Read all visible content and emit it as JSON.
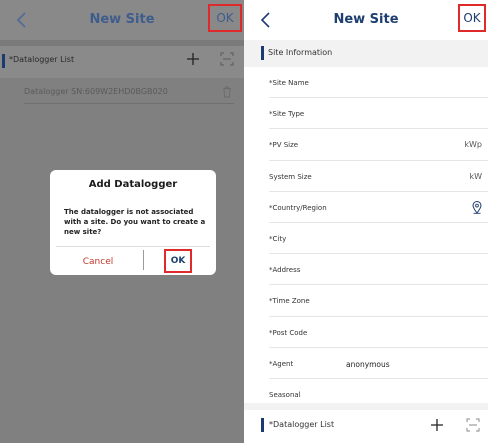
{
  "left_screen": {
    "nav": {
      "title": "New Site",
      "ok_label": "OK"
    },
    "section_label": "*Datalogger List",
    "datalogger_entry": "Datalogger SN:609W2EHD0BGB020",
    "dialog": {
      "title": "Add Datalogger",
      "message": "The datalogger is not associated with a site. Do you want to create a new site?",
      "cancel_label": "Cancel",
      "ok_label": "OK"
    }
  },
  "right_screen": {
    "nav": {
      "title": "New Site",
      "ok_label": "OK"
    },
    "section_label": "Site Information",
    "fields": [
      {
        "label": "*Site Name",
        "value": "",
        "unit": ""
      },
      {
        "label": "*Site Type",
        "value": "",
        "unit": ""
      },
      {
        "label": "*PV Size",
        "value": "",
        "unit": "kWp"
      },
      {
        "label": "System Size",
        "value": "",
        "unit": "kW"
      },
      {
        "label": "*Country/Region",
        "value": "",
        "unit": ""
      },
      {
        "label": "*City",
        "value": "",
        "unit": ""
      },
      {
        "label": "*Address",
        "value": "",
        "unit": ""
      },
      {
        "label": "*Time Zone",
        "value": "",
        "unit": ""
      },
      {
        "label": "*Post Code",
        "value": "",
        "unit": ""
      },
      {
        "label": "*Agent",
        "value": "anonymous",
        "unit": ""
      },
      {
        "label": "Seasonal",
        "value": "",
        "unit": ""
      }
    ],
    "datalogger_section_label": "*Datalogger List"
  },
  "colors": {
    "brand_blue": "#1e3e70",
    "highlight_red": "#e0292a",
    "cancel_red": "#c0392b"
  },
  "icons": [
    "back-chevron-icon",
    "plus-icon",
    "scan-icon",
    "trash-icon",
    "location-pin-icon"
  ]
}
